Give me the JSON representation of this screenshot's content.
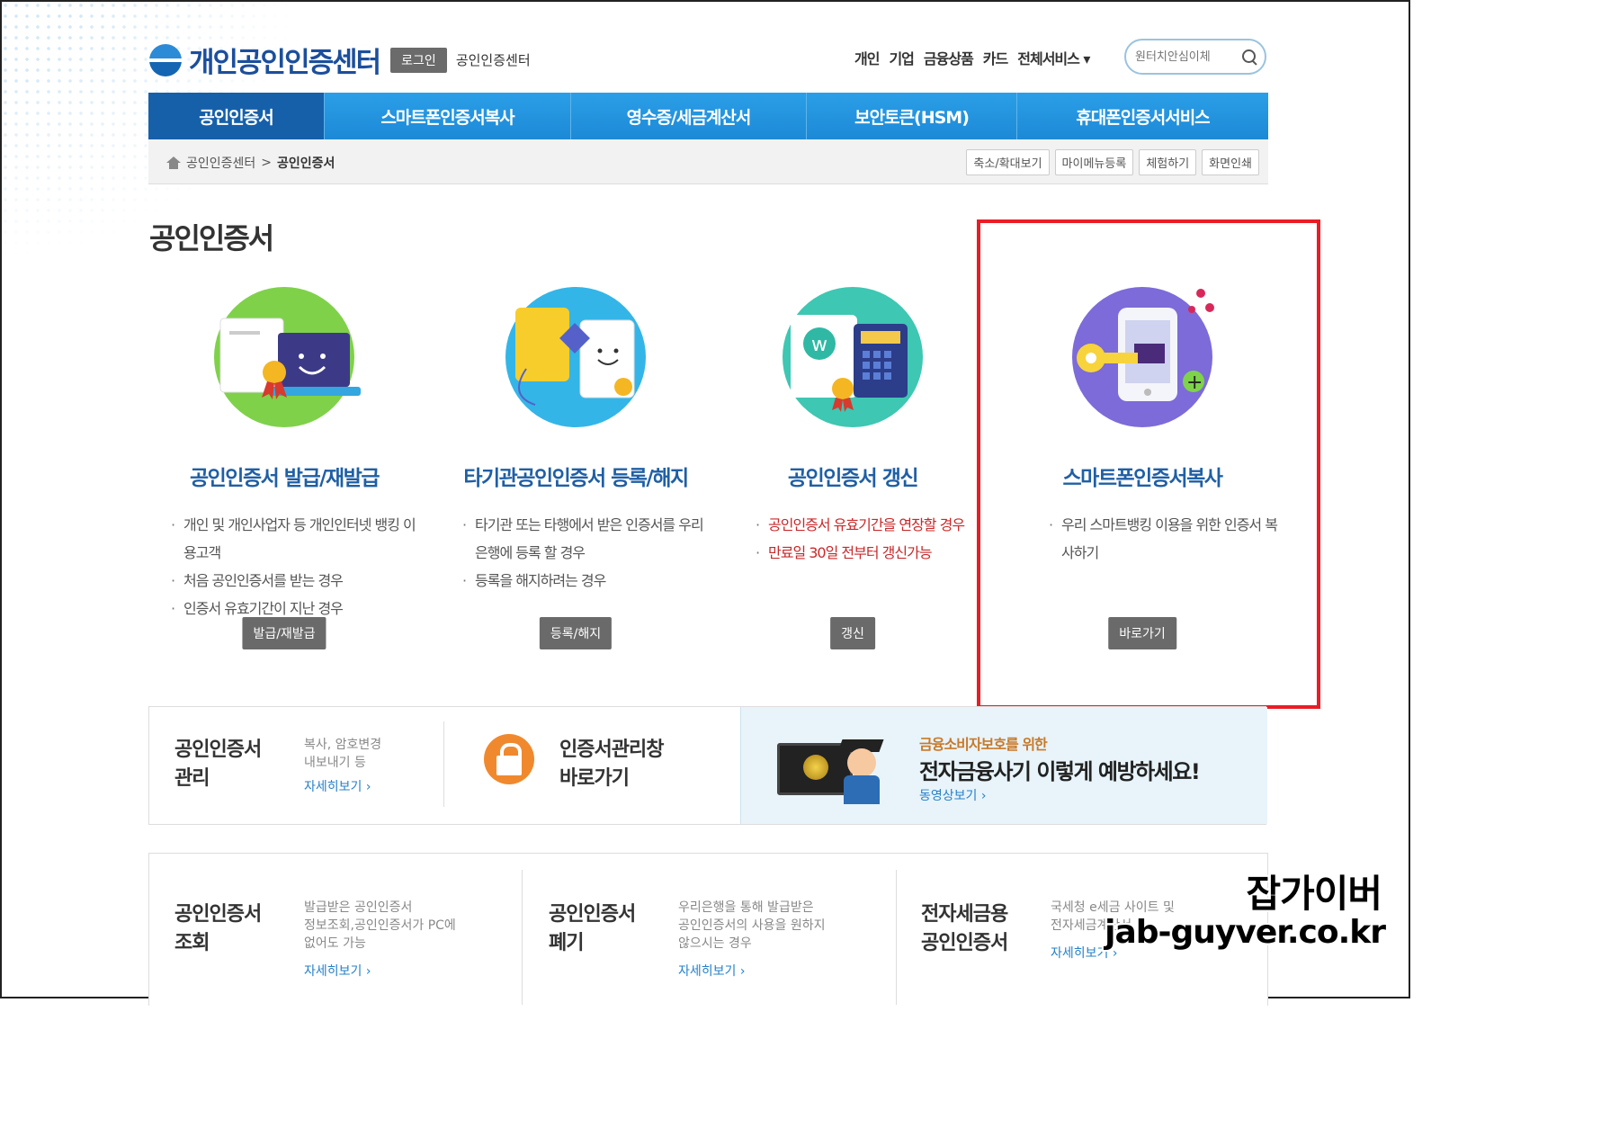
{
  "header": {
    "logo_text": "개인공인인증센터",
    "login_label": "로그인",
    "center_label": "공인인증센터",
    "topnav": [
      "개인",
      "기업",
      "금융상품",
      "카드",
      "전체서비스 ▾"
    ],
    "search_placeholder": "원터치안심이체"
  },
  "mainnav": {
    "tabs": [
      "공인인증서",
      "스마트폰인증서복사",
      "영수증/세금계산서",
      "보안토큰(HSM)",
      "휴대폰인증서서비스"
    ],
    "active_index": 0
  },
  "breadcrumb": {
    "items": [
      "공인인증센터",
      "공인인증서"
    ],
    "separator": ">",
    "tools": [
      "축소/확대보기",
      "마이메뉴등록",
      "체험하기",
      "화면인쇄"
    ]
  },
  "page_title": "공인인증서",
  "services": [
    {
      "name": "공인인증서 발급/재발급",
      "bullets": [
        "개인 및 개인사업자 등 개인인터넷 뱅킹 이용고객",
        "처음 공인인증서를 받는 경우",
        "인증서 유효기간이 지난 경우"
      ],
      "button": "발급/재발급",
      "icon": "certificate-laptop-icon"
    },
    {
      "name": "타기관공인인증서 등록/해지",
      "bullets": [
        "타기관 또는 타행에서 받은 인증서를 우리은행에 등록 할 경우",
        "등록을 해지하려는 경우"
      ],
      "button": "등록/해지",
      "icon": "certificate-transfer-icon"
    },
    {
      "name": "공인인증서 갱신",
      "bullets": [
        "공인인증서 유효기간을 연장할 경우",
        "만료일 30일 전부터 갱신가능"
      ],
      "bullets_red": true,
      "button": "갱신",
      "icon": "certificate-renew-icon"
    },
    {
      "name": "스마트폰인증서복사",
      "bullets": [
        "우리 스마트뱅킹 이용을 위한 인증서 복사하기"
      ],
      "button": "바로가기",
      "icon": "smartphone-key-icon"
    }
  ],
  "manage_panel": {
    "title": "공인인증서\n관리",
    "desc": "복사, 암호변경\n내보내기 등",
    "more": "자세히보기 ›",
    "shortcut_title": "인증서관리창\n바로가기",
    "promo_sub": "금융소비자보호를 위한",
    "promo_main": "전자금융사기 이렇게 예방하세요!",
    "promo_link": "동영상보기 ›"
  },
  "bottom_panel": [
    {
      "title": "공인인증서\n조회",
      "desc": "발급받은 공인인증서\n정보조회,공인인증서가 PC에\n없어도 가능",
      "more": "자세히보기 ›"
    },
    {
      "title": "공인인증서\n폐기",
      "desc": "우리은행을 통해 발급받은\n공인인증서의 사용을 원하지\n않으시는 경우",
      "more": "자세히보기 ›"
    },
    {
      "title": "전자세금용\n공인인증서",
      "desc": "국세청 e세금 사이트 및\n전자세금계산서",
      "more": "자세히보기 ›"
    }
  ],
  "watermark": {
    "line1": "잡가이버",
    "line2": "jab-guyver.co.kr"
  },
  "colors": {
    "nav_blue": "#1d89d6",
    "nav_active": "#1660aa",
    "title_blue": "#1f5fa5",
    "highlight_red": "#ea1d25",
    "orange": "#f0892e"
  }
}
